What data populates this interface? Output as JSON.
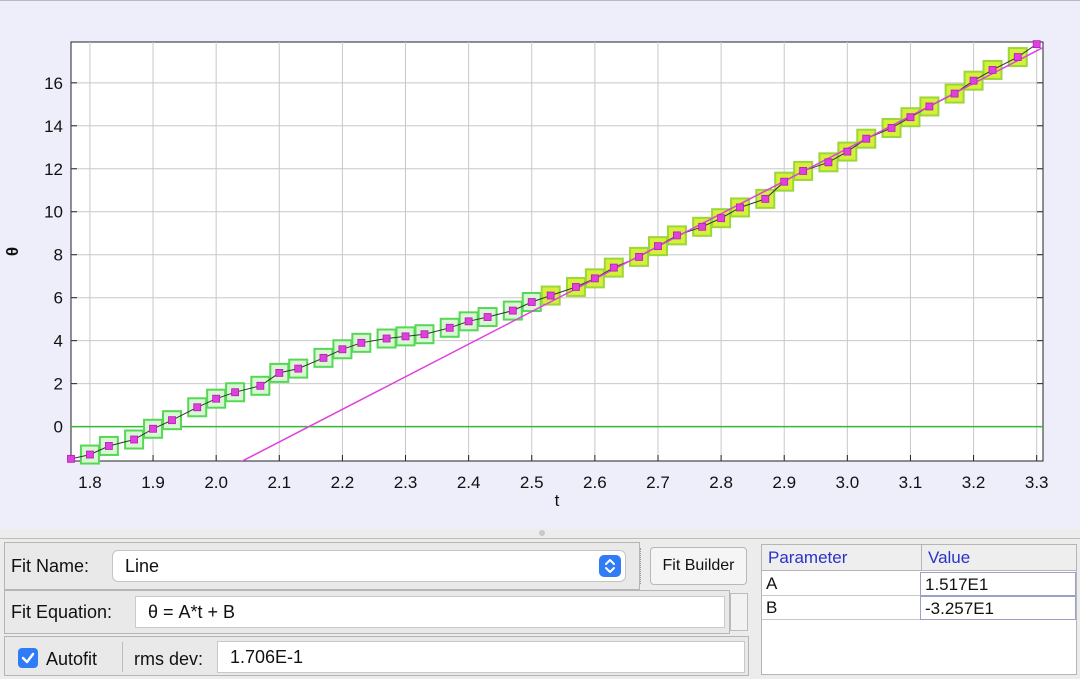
{
  "chart_data": {
    "type": "scatter",
    "xlabel": "t",
    "ylabel": "θ",
    "xlim": [
      1.77,
      3.31
    ],
    "ylim": [
      -1.6,
      17.9
    ],
    "x_ticks": [
      "1.8",
      "1.9",
      "2.0",
      "2.1",
      "2.2",
      "2.3",
      "2.4",
      "2.5",
      "2.6",
      "2.7",
      "2.8",
      "2.9",
      "3.0",
      "3.1",
      "3.2",
      "3.3"
    ],
    "y_ticks": [
      "0",
      "2",
      "4",
      "6",
      "8",
      "10",
      "12",
      "14",
      "16"
    ],
    "grid": true,
    "series": [
      {
        "marker": "square-pink-small",
        "color": "#e040e0",
        "x": [
          1.77,
          1.8,
          1.83,
          1.87,
          1.9,
          1.93,
          1.97,
          2.0,
          2.03,
          2.07,
          2.1,
          2.13,
          2.17,
          2.2,
          2.23,
          2.27,
          2.3,
          2.33,
          2.37,
          2.4,
          2.43,
          2.47,
          2.5,
          2.53,
          2.57,
          2.6,
          2.63,
          2.67,
          2.7,
          2.73,
          2.77,
          2.8,
          2.83,
          2.87,
          2.9,
          2.93,
          2.97,
          3.0,
          3.03,
          3.07,
          3.1,
          3.13,
          3.17,
          3.2,
          3.23,
          3.27,
          3.3
        ],
        "y": [
          -1.5,
          -1.3,
          -0.9,
          -0.6,
          -0.1,
          0.3,
          0.9,
          1.3,
          1.6,
          1.9,
          2.5,
          2.7,
          3.2,
          3.6,
          3.9,
          4.1,
          4.2,
          4.3,
          4.6,
          4.9,
          5.1,
          5.4,
          5.8,
          6.1,
          6.5,
          6.9,
          7.4,
          7.9,
          8.4,
          8.9,
          9.3,
          9.7,
          10.2,
          10.6,
          11.4,
          11.9,
          12.3,
          12.8,
          13.4,
          13.9,
          14.4,
          14.9,
          15.5,
          16.1,
          16.6,
          17.2,
          17.8
        ]
      }
    ],
    "fit_line": {
      "A": 15.17,
      "B": -32.57,
      "color": "#dd44dd"
    },
    "zero_line": {
      "y": 0,
      "color": "#33bb33"
    },
    "highlight_ranges": [
      {
        "from_index": 1,
        "to_index": 22,
        "style": "green-outline"
      },
      {
        "from_index": 23,
        "to_index": 45,
        "style": "yellow-fill"
      }
    ]
  },
  "fit": {
    "name_label": "Fit Name:",
    "name_value": "Line",
    "builder_label": "Fit Builder",
    "equation_label": "Fit Equation:",
    "equation_value": "θ = A*t + B",
    "autofit_label": "Autofit",
    "autofit_checked": true,
    "rms_label": "rms dev:",
    "rms_value": "1.706E-1"
  },
  "params": {
    "headers": [
      "Parameter",
      "Value"
    ],
    "rows": [
      {
        "name": "A",
        "value": "1.517E1"
      },
      {
        "name": "B",
        "value": "-3.257E1"
      }
    ]
  },
  "colors": {
    "plot_bg": "#eeeefa",
    "header_text": "#2a32c8",
    "check_blue": "#2f7cf6"
  }
}
